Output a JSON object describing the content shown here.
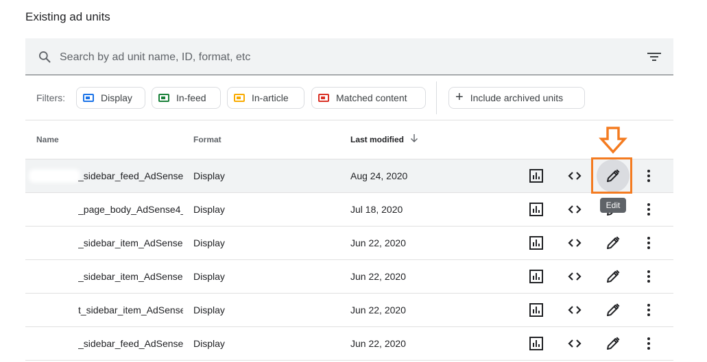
{
  "section_title": "Existing ad units",
  "search": {
    "placeholder": "Search by ad unit name, ID, format, etc"
  },
  "filters": {
    "label": "Filters:",
    "chips": [
      {
        "label": "Display",
        "color": "#1a73e8"
      },
      {
        "label": "In-feed",
        "color": "#188038"
      },
      {
        "label": "In-article",
        "color": "#f9ab00"
      },
      {
        "label": "Matched content",
        "color": "#d93025"
      }
    ],
    "archived_label": "Include archived units"
  },
  "table": {
    "headers": {
      "name": "Name",
      "format": "Format",
      "last_modified": "Last modified"
    },
    "rows": [
      {
        "name": "_sidebar_feed_AdSense",
        "format": "Display",
        "date": "Aug 24, 2020"
      },
      {
        "name": "_page_body_AdSense4_",
        "format": "Display",
        "date": "Jul 18, 2020"
      },
      {
        "name": "_sidebar_item_AdSense",
        "format": "Display",
        "date": "Jun 22, 2020"
      },
      {
        "name": "_sidebar_item_AdSense",
        "format": "Display",
        "date": "Jun 22, 2020"
      },
      {
        "name": "t_sidebar_item_AdSense",
        "format": "Display",
        "date": "Jun 22, 2020"
      },
      {
        "name": "_sidebar_feed_AdSense",
        "format": "Display",
        "date": "Jun 22, 2020"
      }
    ]
  },
  "tooltip": "Edit",
  "accent_color": "#f47b20"
}
